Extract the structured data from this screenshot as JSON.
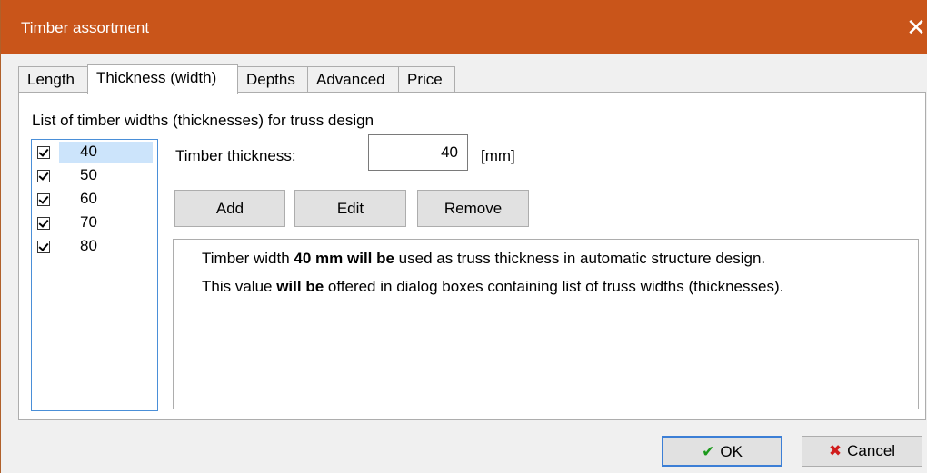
{
  "window": {
    "title": "Timber assortment",
    "close_glyph": "✕",
    "accent_color": "#c9551a"
  },
  "tabs": [
    {
      "label": "Length",
      "active": false
    },
    {
      "label": "Thickness (width)",
      "active": true
    },
    {
      "label": "Depths",
      "active": false
    },
    {
      "label": "Advanced",
      "active": false
    },
    {
      "label": "Price",
      "active": false
    }
  ],
  "panel": {
    "list_title": "List of timber widths (thicknesses) for truss design",
    "widths": [
      {
        "value": "40",
        "checked": true,
        "selected": true
      },
      {
        "value": "50",
        "checked": true,
        "selected": false
      },
      {
        "value": "60",
        "checked": true,
        "selected": false
      },
      {
        "value": "70",
        "checked": true,
        "selected": false
      },
      {
        "value": "80",
        "checked": true,
        "selected": false
      }
    ],
    "thickness_label": "Timber thickness:",
    "thickness_value": "40",
    "unit": "[mm]",
    "buttons": {
      "add": "Add",
      "edit": "Edit",
      "remove": "Remove"
    },
    "info": {
      "line1": {
        "pre": "Timber width ",
        "bold": "40 mm will be",
        "post": " used as truss thickness in automatic structure design."
      },
      "line2": {
        "pre": "This value ",
        "bold": "will be",
        "post": " offered in dialog boxes containing list of truss widths (thicknesses)."
      }
    }
  },
  "footer": {
    "ok_label": "OK",
    "ok_icon": "✔",
    "cancel_label": "Cancel",
    "cancel_icon": "✖"
  }
}
